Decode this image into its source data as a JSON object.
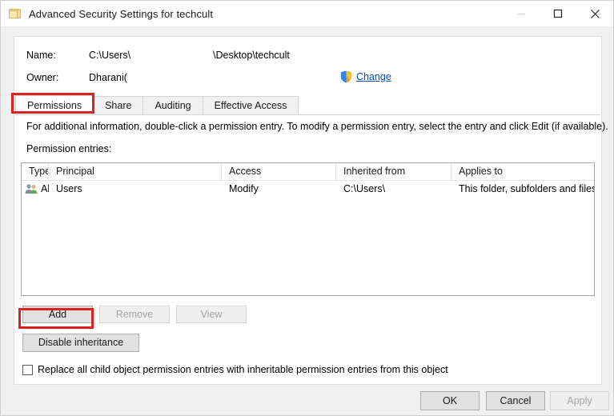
{
  "window": {
    "title": "Advanced Security Settings for techcult",
    "icon": "folder-icon",
    "controls": {
      "minimize": "minimize-icon",
      "maximize": "maximize-icon",
      "close": "close-icon"
    }
  },
  "info": {
    "name_label": "Name:",
    "name_value_prefix": "C:\\Users\\",
    "name_value_suffix": "\\Desktop\\techcult",
    "owner_label": "Owner:",
    "owner_value": "Dharani(",
    "change_link": "Change",
    "change_icon": "uac-shield-icon"
  },
  "tabs": [
    {
      "label": "Permissions",
      "selected": true
    },
    {
      "label": "Share",
      "selected": false
    },
    {
      "label": "Auditing",
      "selected": false
    },
    {
      "label": "Effective Access",
      "selected": false
    }
  ],
  "description": "For additional information, double-click a permission entry. To modify a permission entry, select the entry and click Edit (if available).",
  "entries_label": "Permission entries:",
  "table": {
    "columns": [
      "Type",
      "Principal",
      "Access",
      "Inherited from",
      "Applies to"
    ],
    "rows": [
      {
        "icon": "users-group-icon",
        "type": "Allow",
        "principal": "Users",
        "access": "Modify",
        "inherited_from": "C:\\Users\\",
        "applies_to": "This folder, subfolders and files"
      }
    ]
  },
  "buttons": {
    "add": "Add",
    "add_accesskey": "d",
    "remove": "Remove",
    "remove_accesskey": "R",
    "view": "View",
    "view_accesskey": "V",
    "disable_inheritance": "Disable inheritance",
    "disable_inheritance_accesskey": "i",
    "ok": "OK",
    "cancel": "Cancel",
    "apply": "Apply",
    "apply_accesskey": "A"
  },
  "checkbox": {
    "label": "Replace all child object permission entries with inheritable permission entries from this object",
    "label_accesskey": "p",
    "checked": false
  },
  "annotations": {
    "color": "#e02020",
    "targets": [
      "permissions-tab",
      "add-button"
    ]
  }
}
